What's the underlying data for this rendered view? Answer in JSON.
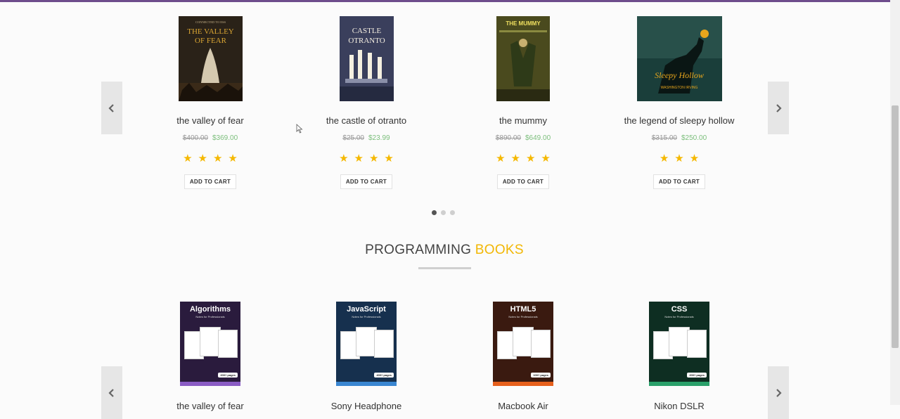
{
  "carousel_top": {
    "products": [
      {
        "title": "the valley of fear",
        "old_price": "$400.00",
        "new_price": "$369.00",
        "rating": 4,
        "stars": "★★★★",
        "cart_label": "ADD TO CART",
        "cover": {
          "top": "CONNECTED TO ESS",
          "line1": "THE VALLEY",
          "line2": "OF FEAR",
          "bg": "#2a2218",
          "fg": "#d9a533"
        }
      },
      {
        "title": "the castle of otranto",
        "old_price": "$25.00",
        "new_price": "$23.99",
        "rating": 4,
        "stars": "★★★★",
        "cart_label": "ADD TO CART",
        "cover": {
          "line1": "CASTLE",
          "line2": "OTRANTO",
          "bg": "#3a3f5c",
          "fg": "#f3ede0"
        }
      },
      {
        "title": "the mummy",
        "old_price": "$890.00",
        "new_price": "$649.00",
        "rating": 4,
        "stars": "★★★★",
        "cart_label": "ADD TO CART",
        "cover": {
          "line1": "THE MUMMY",
          "bg": "#4a4a1e",
          "fg": "#f0e060"
        }
      },
      {
        "title": "the legend of sleepy hollow",
        "old_price": "$315.00",
        "new_price": "$250.00",
        "rating": 3,
        "stars": "★★★",
        "cart_label": "ADD TO CART",
        "cover": {
          "line1": "Sleepy Hollow",
          "line2": "WASHINGTON IRVING",
          "bg": "#1a3e3a",
          "fg": "#e8a61c"
        }
      }
    ],
    "dots": [
      true,
      false,
      false
    ]
  },
  "section": {
    "title_main": "PROGRAMMING ",
    "title_accent": "BOOKS"
  },
  "carousel_bottom": {
    "books": [
      {
        "cover_title": "Algorithms",
        "subtitle": "Notes for Professionals",
        "badge": "200+ pages",
        "bg": "#2a1b3d",
        "strip": "#8a5cc4"
      },
      {
        "cover_title": "JavaScript",
        "subtitle": "Notes for Professionals",
        "badge": "400+ pages",
        "bg": "#16304e",
        "strip": "#3a86d1"
      },
      {
        "cover_title": "HTML5",
        "subtitle": "Notes for Professionals",
        "badge": "100+ pages",
        "bg": "#3a1a10",
        "strip": "#e6601c"
      },
      {
        "cover_title": "CSS",
        "subtitle": "Notes for Professionals",
        "badge": "200+ pages",
        "bg": "#0e2e22",
        "strip": "#2aa06a"
      }
    ],
    "titles": [
      "the valley of fear",
      "Sony Headphone",
      "Macbook Air",
      "Nikon DSLR"
    ]
  },
  "icons": {
    "prev": "chevron-left-icon",
    "next": "chevron-right-icon"
  },
  "colors": {
    "accent": "#f2b705",
    "top_bar": "#6e4d8c",
    "star": "#f5b800",
    "sale_price": "#7cbf7c"
  }
}
